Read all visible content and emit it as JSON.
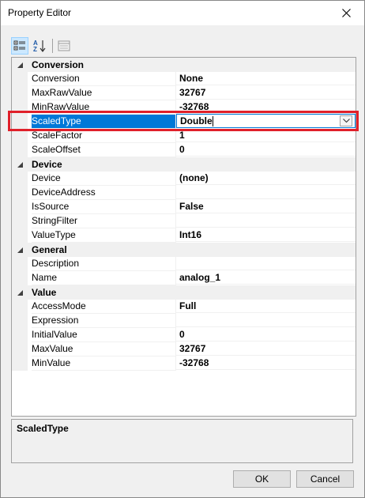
{
  "window": {
    "title": "Property Editor"
  },
  "toolbar": {
    "categorized": {
      "icon": "categorized-icon"
    },
    "alphabetical": {
      "icon": "sort-az-icon"
    },
    "property_pages": {
      "icon": "property-pages-icon"
    }
  },
  "grid": {
    "categories": [
      {
        "label": "Conversion",
        "properties": [
          {
            "name": "Conversion",
            "value": "None"
          },
          {
            "name": "MaxRawValue",
            "value": "32767"
          },
          {
            "name": "MinRawValue",
            "value": "-32768"
          },
          {
            "name": "ScaledType",
            "value": "Double",
            "selected": true
          },
          {
            "name": "ScaleFactor",
            "value": "1"
          },
          {
            "name": "ScaleOffset",
            "value": "0"
          }
        ]
      },
      {
        "label": "Device",
        "properties": [
          {
            "name": "Device",
            "value": "(none)"
          },
          {
            "name": "DeviceAddress",
            "value": ""
          },
          {
            "name": "IsSource",
            "value": "False"
          },
          {
            "name": "StringFilter",
            "value": ""
          },
          {
            "name": "ValueType",
            "value": "Int16"
          }
        ]
      },
      {
        "label": "General",
        "properties": [
          {
            "name": "Description",
            "value": ""
          },
          {
            "name": "Name",
            "value": "analog_1"
          }
        ]
      },
      {
        "label": "Value",
        "properties": [
          {
            "name": "AccessMode",
            "value": "Full"
          },
          {
            "name": "Expression",
            "value": ""
          },
          {
            "name": "InitialValue",
            "value": "0"
          },
          {
            "name": "MaxValue",
            "value": "32767"
          },
          {
            "name": "MinValue",
            "value": "-32768"
          }
        ]
      }
    ]
  },
  "description": {
    "title": "ScaledType"
  },
  "buttons": {
    "ok": "OK",
    "cancel": "Cancel"
  },
  "colors": {
    "selection": "#0078d7",
    "highlight_frame": "#e0202a"
  }
}
